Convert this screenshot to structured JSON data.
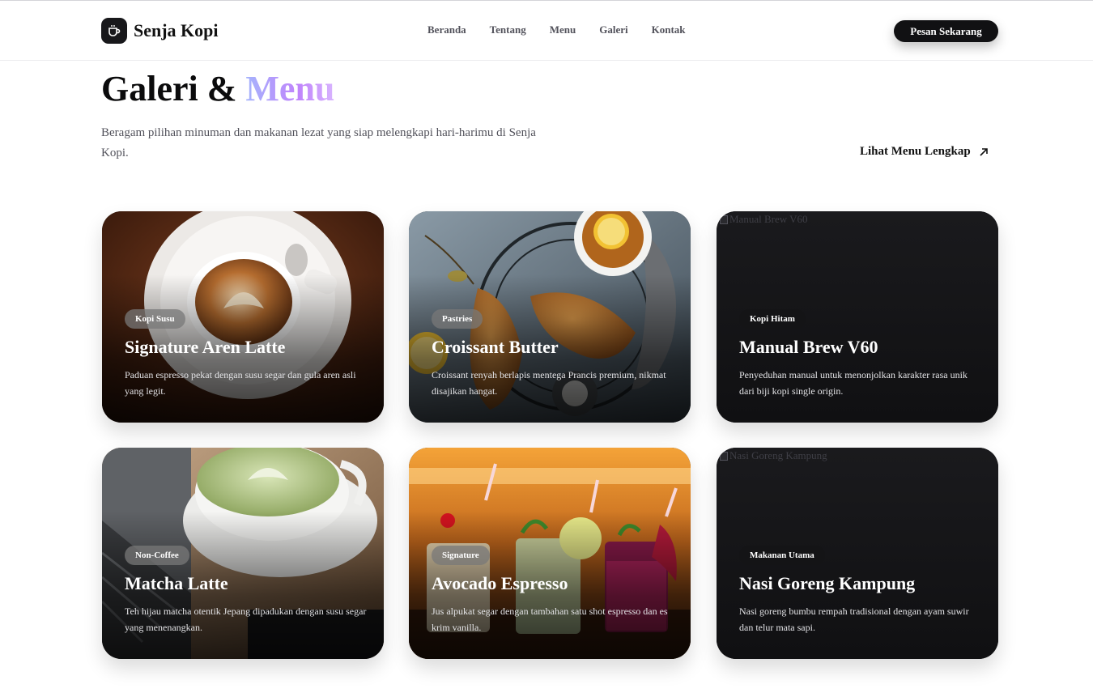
{
  "brand": {
    "name": "Senja Kopi",
    "logo_icon": "coffee-cup-icon"
  },
  "nav": {
    "items": [
      "Beranda",
      "Tentang",
      "Menu",
      "Galeri",
      "Kontak"
    ]
  },
  "header": {
    "cta_label": "Pesan Sekarang"
  },
  "section": {
    "title_main": "Galeri &",
    "title_accent": "Menu",
    "subtitle": "Beragam pilihan minuman dan makanan lezat yang siap melengkapi hari-harimu di Senja Kopi.",
    "link_label": "Lihat Menu Lengkap",
    "link_icon": "arrow-up-right-icon"
  },
  "cards": [
    {
      "badge": "Kopi Susu",
      "title": "Signature Aren Latte",
      "desc": "Paduan espresso pekat dengan susu segar dan gula aren asli yang legit.",
      "image": "latte-art-photo"
    },
    {
      "badge": "Pastries",
      "title": "Croissant Butter",
      "desc": "Croissant renyah berlapis mentega Prancis premium, nikmat disajikan hangat.",
      "image": "croissant-tea-photo"
    },
    {
      "badge": "Kopi Hitam",
      "title": "Manual Brew V60",
      "desc": "Penyeduhan manual untuk menonjolkan karakter rasa unik dari biji kopi single origin.",
      "image_alt": "Manual Brew V60"
    },
    {
      "badge": "Non-Coffee",
      "title": "Matcha Latte",
      "desc": "Teh hijau matcha otentik Jepang dipadukan dengan susu segar yang menenangkan.",
      "image": "matcha-latte-photo"
    },
    {
      "badge": "Signature",
      "title": "Avocado Espresso",
      "desc": "Jus alpukat segar dengan tambahan satu shot espresso dan es krim vanilla.",
      "image": "mocktails-photo"
    },
    {
      "badge": "Makanan Utama",
      "title": "Nasi Goreng Kampung",
      "desc": "Nasi goreng bumbu rempah tradisional dengan ayam suwir dan telur mata sapi.",
      "image_alt": "Nasi Goreng Kampung"
    }
  ],
  "colors": {
    "primary": "#111113",
    "accent_gradient_start": "#a5b4fc",
    "accent_gradient_end": "#c084fc"
  }
}
